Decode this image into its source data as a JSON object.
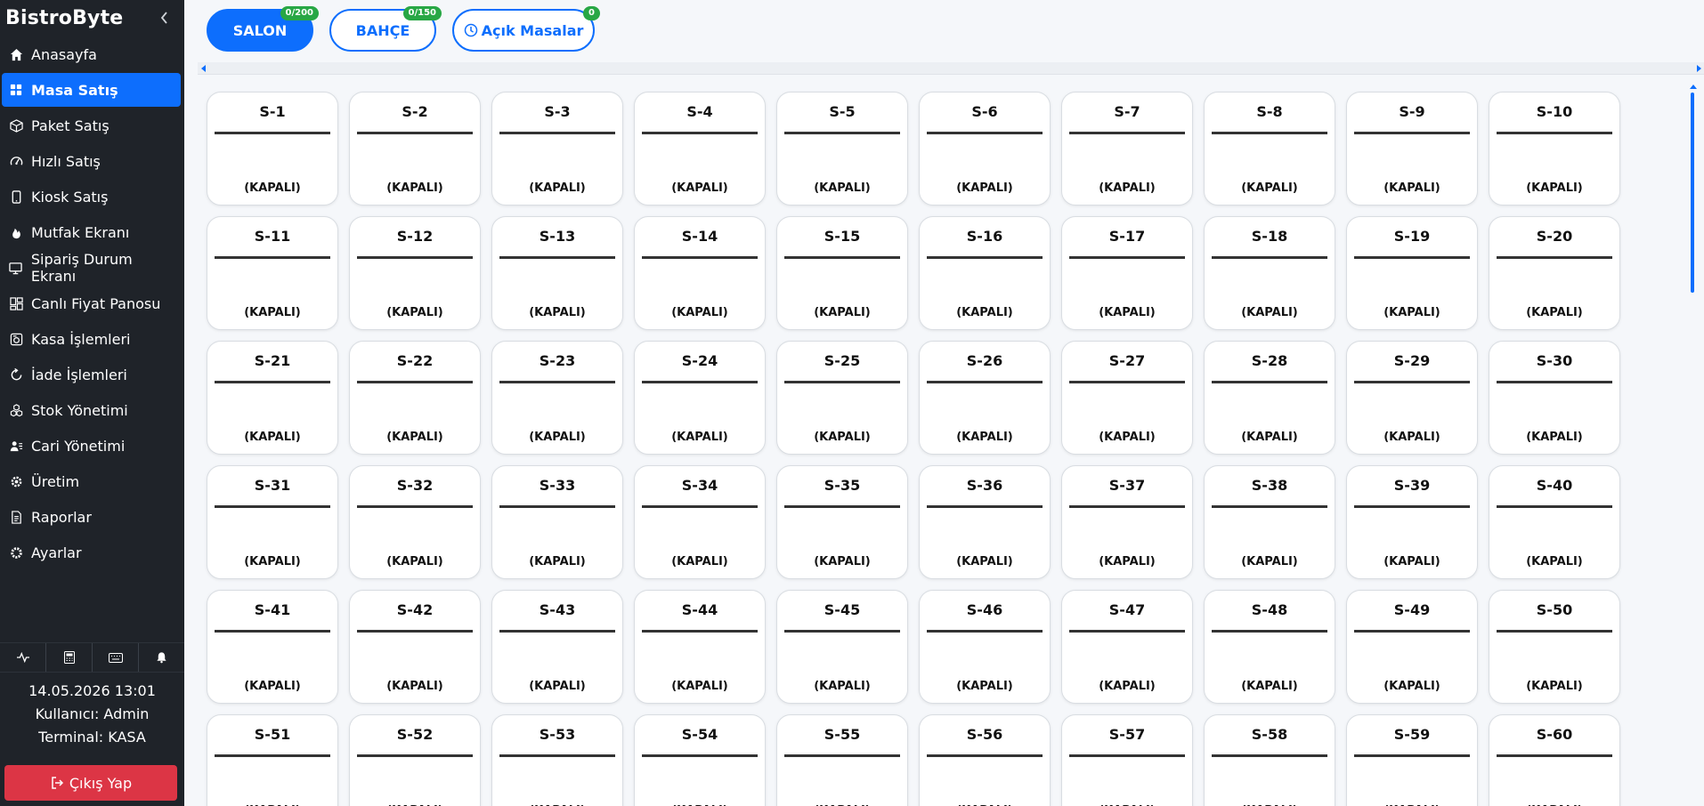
{
  "app": {
    "brand": "BistroByte"
  },
  "sidebar": {
    "items": [
      {
        "label": "Anasayfa",
        "icon": "home-icon",
        "name": "sidebar-item-anasayfa"
      },
      {
        "label": "Masa Satış",
        "icon": "grid-icon",
        "name": "sidebar-item-masa-satis",
        "active": true
      },
      {
        "label": "Paket Satış",
        "icon": "box-icon",
        "name": "sidebar-item-paket-satis"
      },
      {
        "label": "Hızlı Satış",
        "icon": "speedometer-icon",
        "name": "sidebar-item-hizli-satis"
      },
      {
        "label": "Kiosk Satış",
        "icon": "tablet-icon",
        "name": "sidebar-item-kiosk-satis"
      },
      {
        "label": "Mutfak Ekranı",
        "icon": "fire-icon",
        "name": "sidebar-item-mutfak-ekrani"
      },
      {
        "label": "Sipariş Durum Ekranı",
        "icon": "monitor-icon",
        "name": "sidebar-item-siparis-durum-ekrani"
      },
      {
        "label": "Canlı Fiyat Panosu",
        "icon": "board-icon",
        "name": "sidebar-item-canli-fiyat-panosu"
      },
      {
        "label": "Kasa İşlemleri",
        "icon": "cash-register-icon",
        "name": "sidebar-item-kasa-islemleri"
      },
      {
        "label": "İade İşlemleri",
        "icon": "refresh-icon",
        "name": "sidebar-item-iade-islemleri"
      },
      {
        "label": "Stok Yönetimi",
        "icon": "boxes-icon",
        "name": "sidebar-item-stok-yonetimi"
      },
      {
        "label": "Cari Yönetimi",
        "icon": "person-lines-icon",
        "name": "sidebar-item-cari-yonetimi"
      },
      {
        "label": "Üretim",
        "icon": "gear-icon",
        "name": "sidebar-item-uretim"
      },
      {
        "label": "Raporlar",
        "icon": "document-icon",
        "name": "sidebar-item-raporlar"
      },
      {
        "label": "Ayarlar",
        "icon": "settings-icon",
        "name": "sidebar-item-ayarlar"
      }
    ],
    "tools": [
      {
        "icon": "activity-icon",
        "name": "activity-button"
      },
      {
        "icon": "calculator-icon",
        "name": "calculator-button"
      },
      {
        "icon": "keyboard-icon",
        "name": "keyboard-button"
      },
      {
        "icon": "bell-icon",
        "name": "notifications-button"
      }
    ],
    "info": {
      "datetime": "14.05.2026  13:01",
      "user": "Kullanıcı: Admin",
      "terminal": "Terminal: KASA"
    },
    "logout_label": "Çıkış Yap"
  },
  "tabs": [
    {
      "label": "SALON",
      "badge": "0/200",
      "active": true,
      "name": "tab-salon"
    },
    {
      "label": "BAHÇE",
      "badge": "0/150",
      "active": false,
      "name": "tab-bahce"
    },
    {
      "label": "Açık Masalar",
      "badge": "0",
      "active": false,
      "name": "tab-acik-masalar",
      "icon": "clock-icon"
    }
  ],
  "tables": {
    "status_label": "(KAPALI)",
    "items": [
      "S-1",
      "S-2",
      "S-3",
      "S-4",
      "S-5",
      "S-6",
      "S-7",
      "S-8",
      "S-9",
      "S-10",
      "S-11",
      "S-12",
      "S-13",
      "S-14",
      "S-15",
      "S-16",
      "S-17",
      "S-18",
      "S-19",
      "S-20",
      "S-21",
      "S-22",
      "S-23",
      "S-24",
      "S-25",
      "S-26",
      "S-27",
      "S-28",
      "S-29",
      "S-30",
      "S-31",
      "S-32",
      "S-33",
      "S-34",
      "S-35",
      "S-36",
      "S-37",
      "S-38",
      "S-39",
      "S-40",
      "S-41",
      "S-42",
      "S-43",
      "S-44",
      "S-45",
      "S-46",
      "S-47",
      "S-48",
      "S-49",
      "S-50",
      "S-51",
      "S-52",
      "S-53",
      "S-54",
      "S-55",
      "S-56",
      "S-57",
      "S-58",
      "S-59",
      "S-60"
    ]
  },
  "colors": {
    "primary": "#0d6efd",
    "sidebar_bg": "#1f2329",
    "danger": "#dc3545",
    "badge": "#28a745"
  }
}
